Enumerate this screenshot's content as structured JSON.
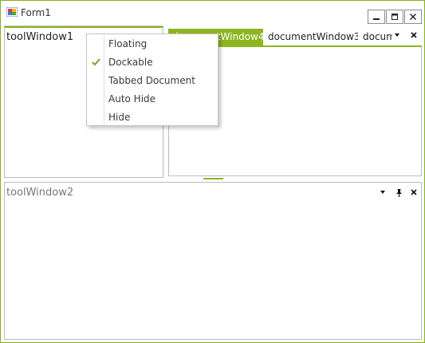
{
  "window": {
    "title": "Form1"
  },
  "colors": {
    "accent": "#8db520",
    "border": "#8aaf1f",
    "pane_border": "#bcbcbc"
  },
  "caption_buttons": [
    {
      "name": "minimize",
      "icon": "minimize-icon"
    },
    {
      "name": "maximize",
      "icon": "maximize-icon"
    },
    {
      "name": "close",
      "icon": "close-icon"
    }
  ],
  "tool_window_1": {
    "title": "toolWindow1"
  },
  "document_tabs": {
    "tabs": [
      {
        "label": "documentWindow4",
        "active": true
      },
      {
        "label": "documentWindow3",
        "active": false
      },
      {
        "label": "documentWindow",
        "active": false
      }
    ],
    "buttons": [
      "chevron-down-icon",
      "close-icon"
    ]
  },
  "tool_window_2": {
    "title": "toolWindow2",
    "buttons": [
      "chevron-down-icon",
      "pin-icon",
      "close-icon"
    ]
  },
  "context_menu": {
    "items": [
      {
        "label": "Floating",
        "checked": false
      },
      {
        "label": "Dockable",
        "checked": true
      },
      {
        "label": "Tabbed Document",
        "checked": false
      },
      {
        "label": "Auto Hide",
        "checked": false
      },
      {
        "label": "Hide",
        "checked": false
      }
    ]
  }
}
